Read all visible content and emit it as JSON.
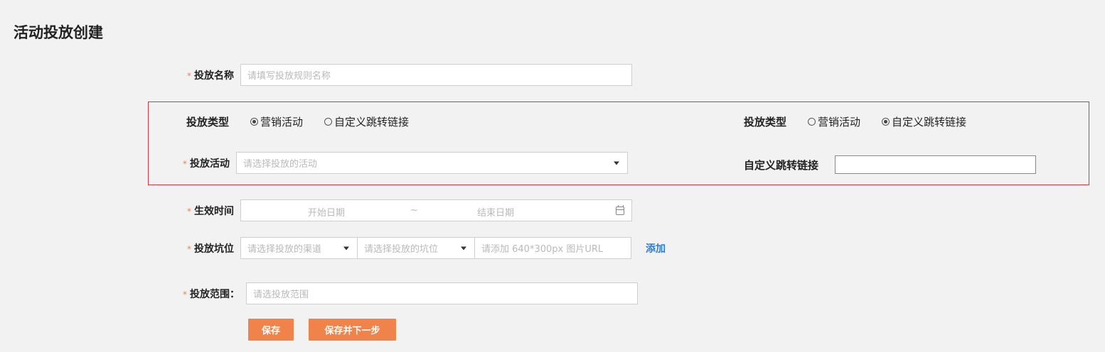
{
  "page": {
    "title": "活动投放创建"
  },
  "required_mark": "*",
  "form": {
    "name": {
      "label": "投放名称",
      "placeholder": "请填写投放规则名称"
    },
    "type_left": {
      "label": "投放类型",
      "options": [
        "营销活动",
        "自定义跳转链接"
      ],
      "selected": "营销活动"
    },
    "activity": {
      "label": "投放活动",
      "placeholder": "请选择投放的活动"
    },
    "type_right": {
      "label": "投放类型",
      "options": [
        "营销活动",
        "自定义跳转链接"
      ],
      "selected": "自定义跳转链接"
    },
    "custom_link": {
      "label": "自定义跳转链接",
      "value": ""
    },
    "time": {
      "label": "生效时间",
      "start_placeholder": "开始日期",
      "separator": "~",
      "end_placeholder": "结束日期"
    },
    "slot": {
      "label": "投放坑位",
      "channel_placeholder": "请选择投放的渠道",
      "position_placeholder": "请选择投放的坑位",
      "url_placeholder": "请添加 640*300px 图片URL",
      "add_label": "添加"
    },
    "scope": {
      "label": "投放范围：",
      "placeholder": "请选投放范围"
    }
  },
  "buttons": {
    "save": "保存",
    "save_next": "保存并下一步"
  },
  "colors": {
    "accent": "#f0834a",
    "link": "#2e7cd6",
    "highlight_border": "#d9363e",
    "background": "#f2f2f2"
  }
}
